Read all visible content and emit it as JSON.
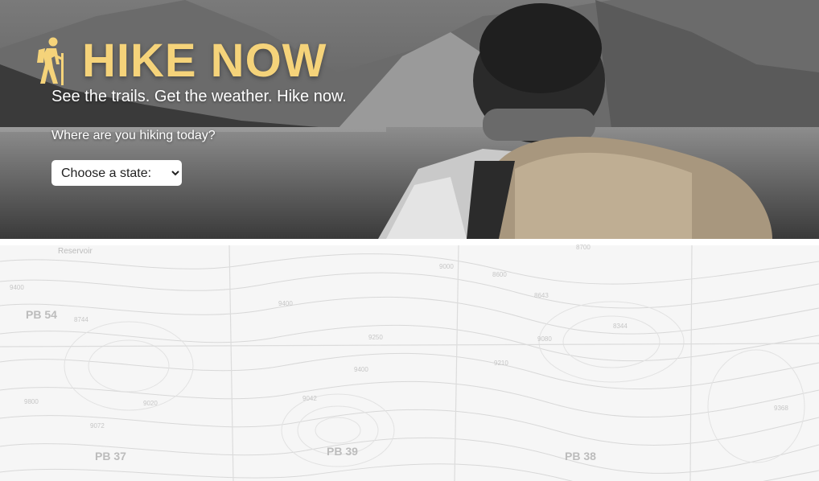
{
  "header": {
    "title": "HIKE NOW",
    "tagline": "See the trails. Get the weather. Hike now.",
    "prompt": "Where are you hiking today?",
    "logo_icon": "hiker-icon",
    "accent_color": "#f5d37a"
  },
  "state_select": {
    "selected": "Choose a state:",
    "options": [
      "Choose a state:"
    ]
  },
  "map": {
    "labels": [
      "PB 54",
      "PB 37",
      "PB 39",
      "PB 38",
      "Reservoir"
    ],
    "elevations": [
      "9400",
      "8744",
      "9000",
      "8643",
      "8700",
      "8344",
      "9400",
      "9250",
      "9210",
      "9080",
      "9020",
      "9072",
      "9042",
      "9800",
      "9368",
      "8600",
      "9400"
    ]
  }
}
